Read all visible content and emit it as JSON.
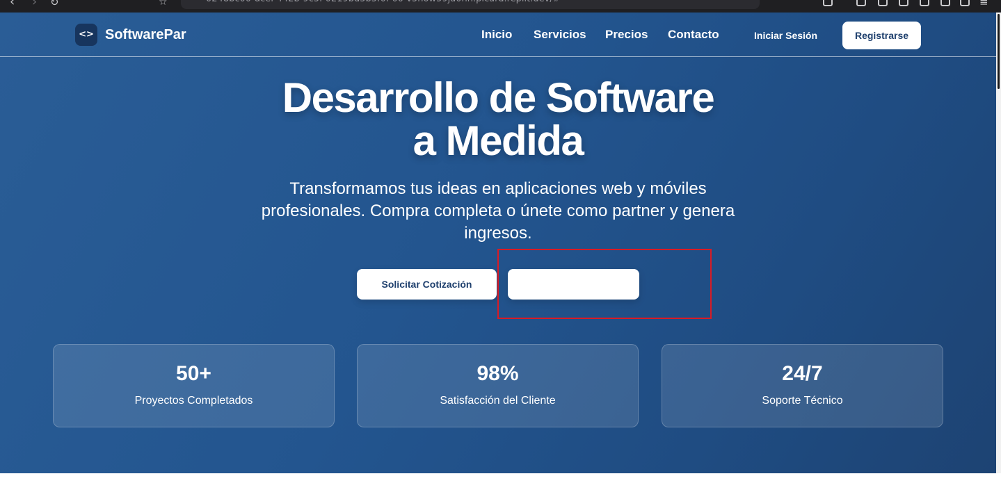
{
  "browser": {
    "url": "0248bc00-dcef-442b-9c5f-0219bd5b5f0f-00-v5how59ja0nn.picard.replit.dev/#"
  },
  "navbar": {
    "logo_glyph": "<>",
    "brand": "SoftwarePar",
    "links": [
      "Inicio",
      "Servicios",
      "Precios",
      "Contacto"
    ],
    "login": "Iniciar Sesión",
    "register": "Registrarse"
  },
  "hero": {
    "title_line1": "Desarrollo de Software",
    "title_line2": "a Medida",
    "subtitle": "Transformamos tus ideas en aplicaciones web y móviles profesionales. Compra completa o únete como partner y genera ingresos.",
    "primary_button": "Solicitar Cotización",
    "secondary_button": ""
  },
  "stats": [
    {
      "value": "50+",
      "label": "Proyectos Completados"
    },
    {
      "value": "98%",
      "label": "Satisfacción del Cliente"
    },
    {
      "value": "24/7",
      "label": "Soporte Técnico"
    }
  ],
  "colors": {
    "hero_gradient_start": "#2a5d96",
    "hero_gradient_end": "#1d4373",
    "accent_text": "#1e3f6d",
    "highlight": "#d81b25"
  }
}
